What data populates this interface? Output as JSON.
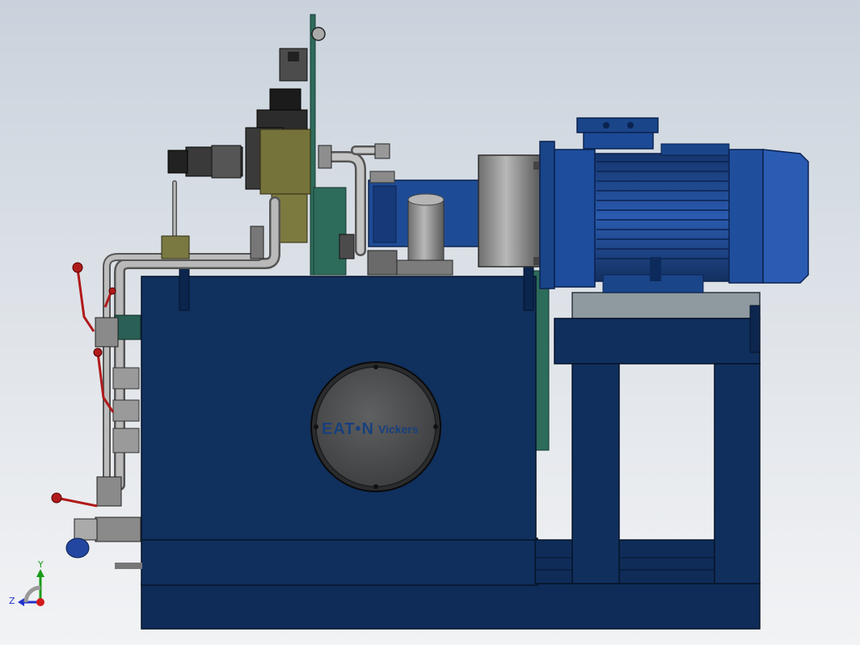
{
  "nameplate": {
    "brand": "EAT•N",
    "subbrand": "Vickers"
  },
  "triad": {
    "y_label": "Y",
    "z_label": "Z"
  },
  "colors": {
    "background_top": "#c9d2dc",
    "tank_blue": "#10305e",
    "motor_blue": "#1f4b94",
    "steel_gray": "#8d8d8d",
    "dark_metal": "#2a2a2a",
    "olive": "#76733a",
    "teal_plate": "#2d6b5b",
    "handle_red": "#b01a1a"
  }
}
